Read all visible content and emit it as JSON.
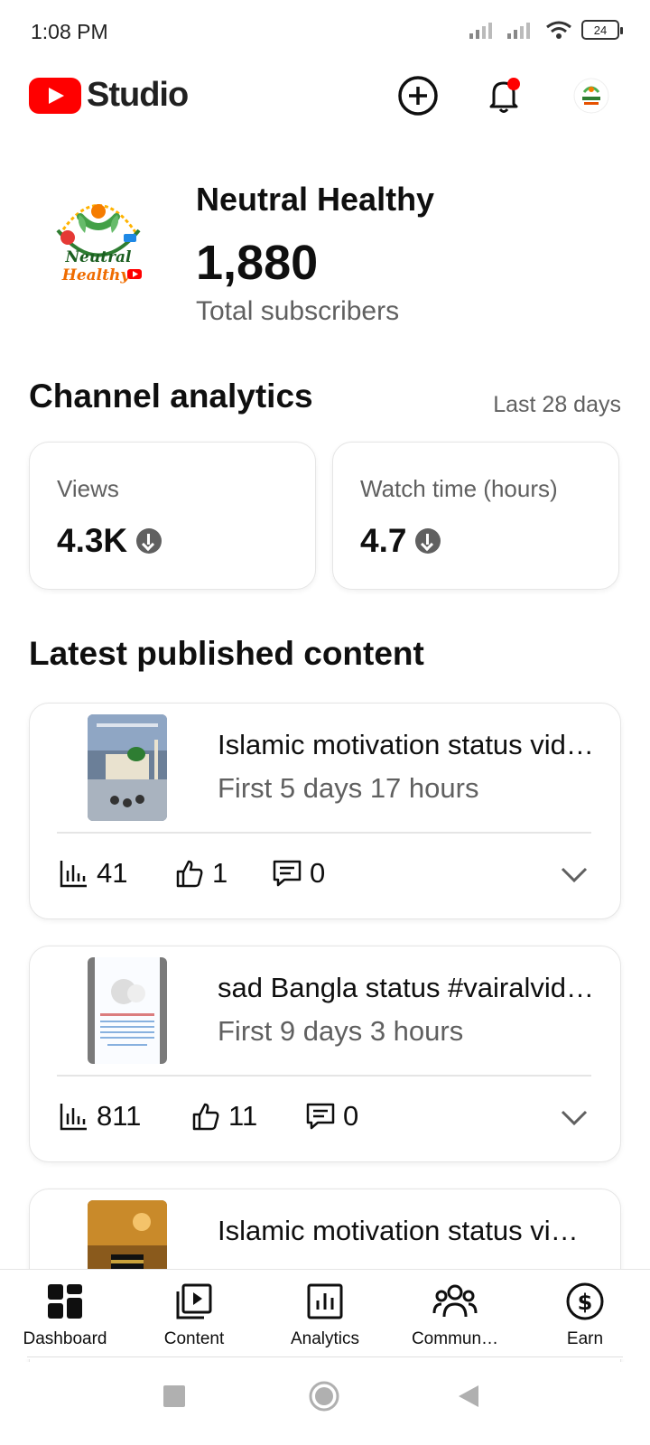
{
  "status_bar": {
    "time": "1:08 PM",
    "battery": "24"
  },
  "header": {
    "app_name": "Studio"
  },
  "channel": {
    "name": "Neutral Healthy",
    "subscribers": "1,880",
    "subscribers_label": "Total subscribers",
    "logo_text": [
      "Neutral",
      "Healthy"
    ]
  },
  "analytics": {
    "title": "Channel analytics",
    "range": "Last 28 days",
    "metrics": [
      {
        "label": "Views",
        "value": "4.3K",
        "trend": "down"
      },
      {
        "label": "Watch time (hours)",
        "value": "4.7",
        "trend": "down"
      }
    ]
  },
  "latest": {
    "title": "Latest published content",
    "videos": [
      {
        "title": "Islamic motivation status video",
        "subtitle": "First 5 days 17 hours",
        "views": "41",
        "likes": "1",
        "comments": "0"
      },
      {
        "title": "sad Bangla status #vairalvideo",
        "subtitle": "First 9 days 3 hours",
        "views": "811",
        "likes": "11",
        "comments": "0"
      },
      {
        "title": "Islamic motivation status video",
        "subtitle": "",
        "views": "",
        "likes": "",
        "comments": ""
      }
    ]
  },
  "bottom_nav": [
    {
      "label": "Dashboard",
      "icon": "dashboard-icon",
      "active": true
    },
    {
      "label": "Content",
      "icon": "content-icon"
    },
    {
      "label": "Analytics",
      "icon": "analytics-icon"
    },
    {
      "label": "Commun…",
      "icon": "community-icon"
    },
    {
      "label": "Earn",
      "icon": "earn-icon"
    }
  ],
  "colors": {
    "brand_red": "#ff0000",
    "text_primary": "#0f0f0f",
    "text_secondary": "#606060"
  }
}
